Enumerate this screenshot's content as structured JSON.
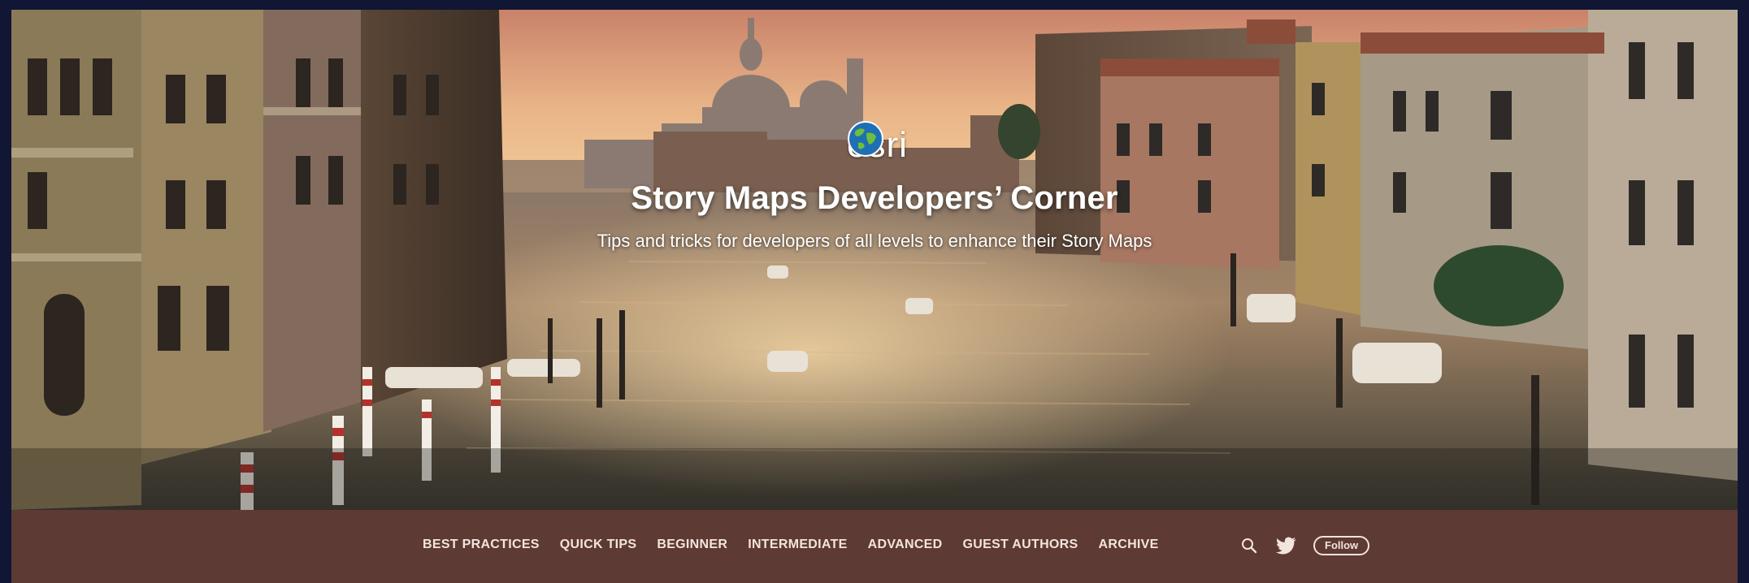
{
  "brand": {
    "logo_text": "esri",
    "logo_icon": "globe-icon"
  },
  "header": {
    "title": "Story Maps Developers’ Corner",
    "tagline": "Tips and tricks for developers of all levels to enhance their Story Maps"
  },
  "nav": {
    "items": [
      {
        "label": "BEST PRACTICES"
      },
      {
        "label": "QUICK TIPS"
      },
      {
        "label": "BEGINNER"
      },
      {
        "label": "INTERMEDIATE"
      },
      {
        "label": "ADVANCED"
      },
      {
        "label": "GUEST AUTHORS"
      },
      {
        "label": "ARCHIVE"
      }
    ],
    "follow_label": "Follow",
    "search_icon": "search-icon",
    "twitter_icon": "twitter-icon"
  },
  "colors": {
    "navbar_bg": "#5d3a33",
    "nav_text": "#f3e4de",
    "frame": "#101633"
  }
}
